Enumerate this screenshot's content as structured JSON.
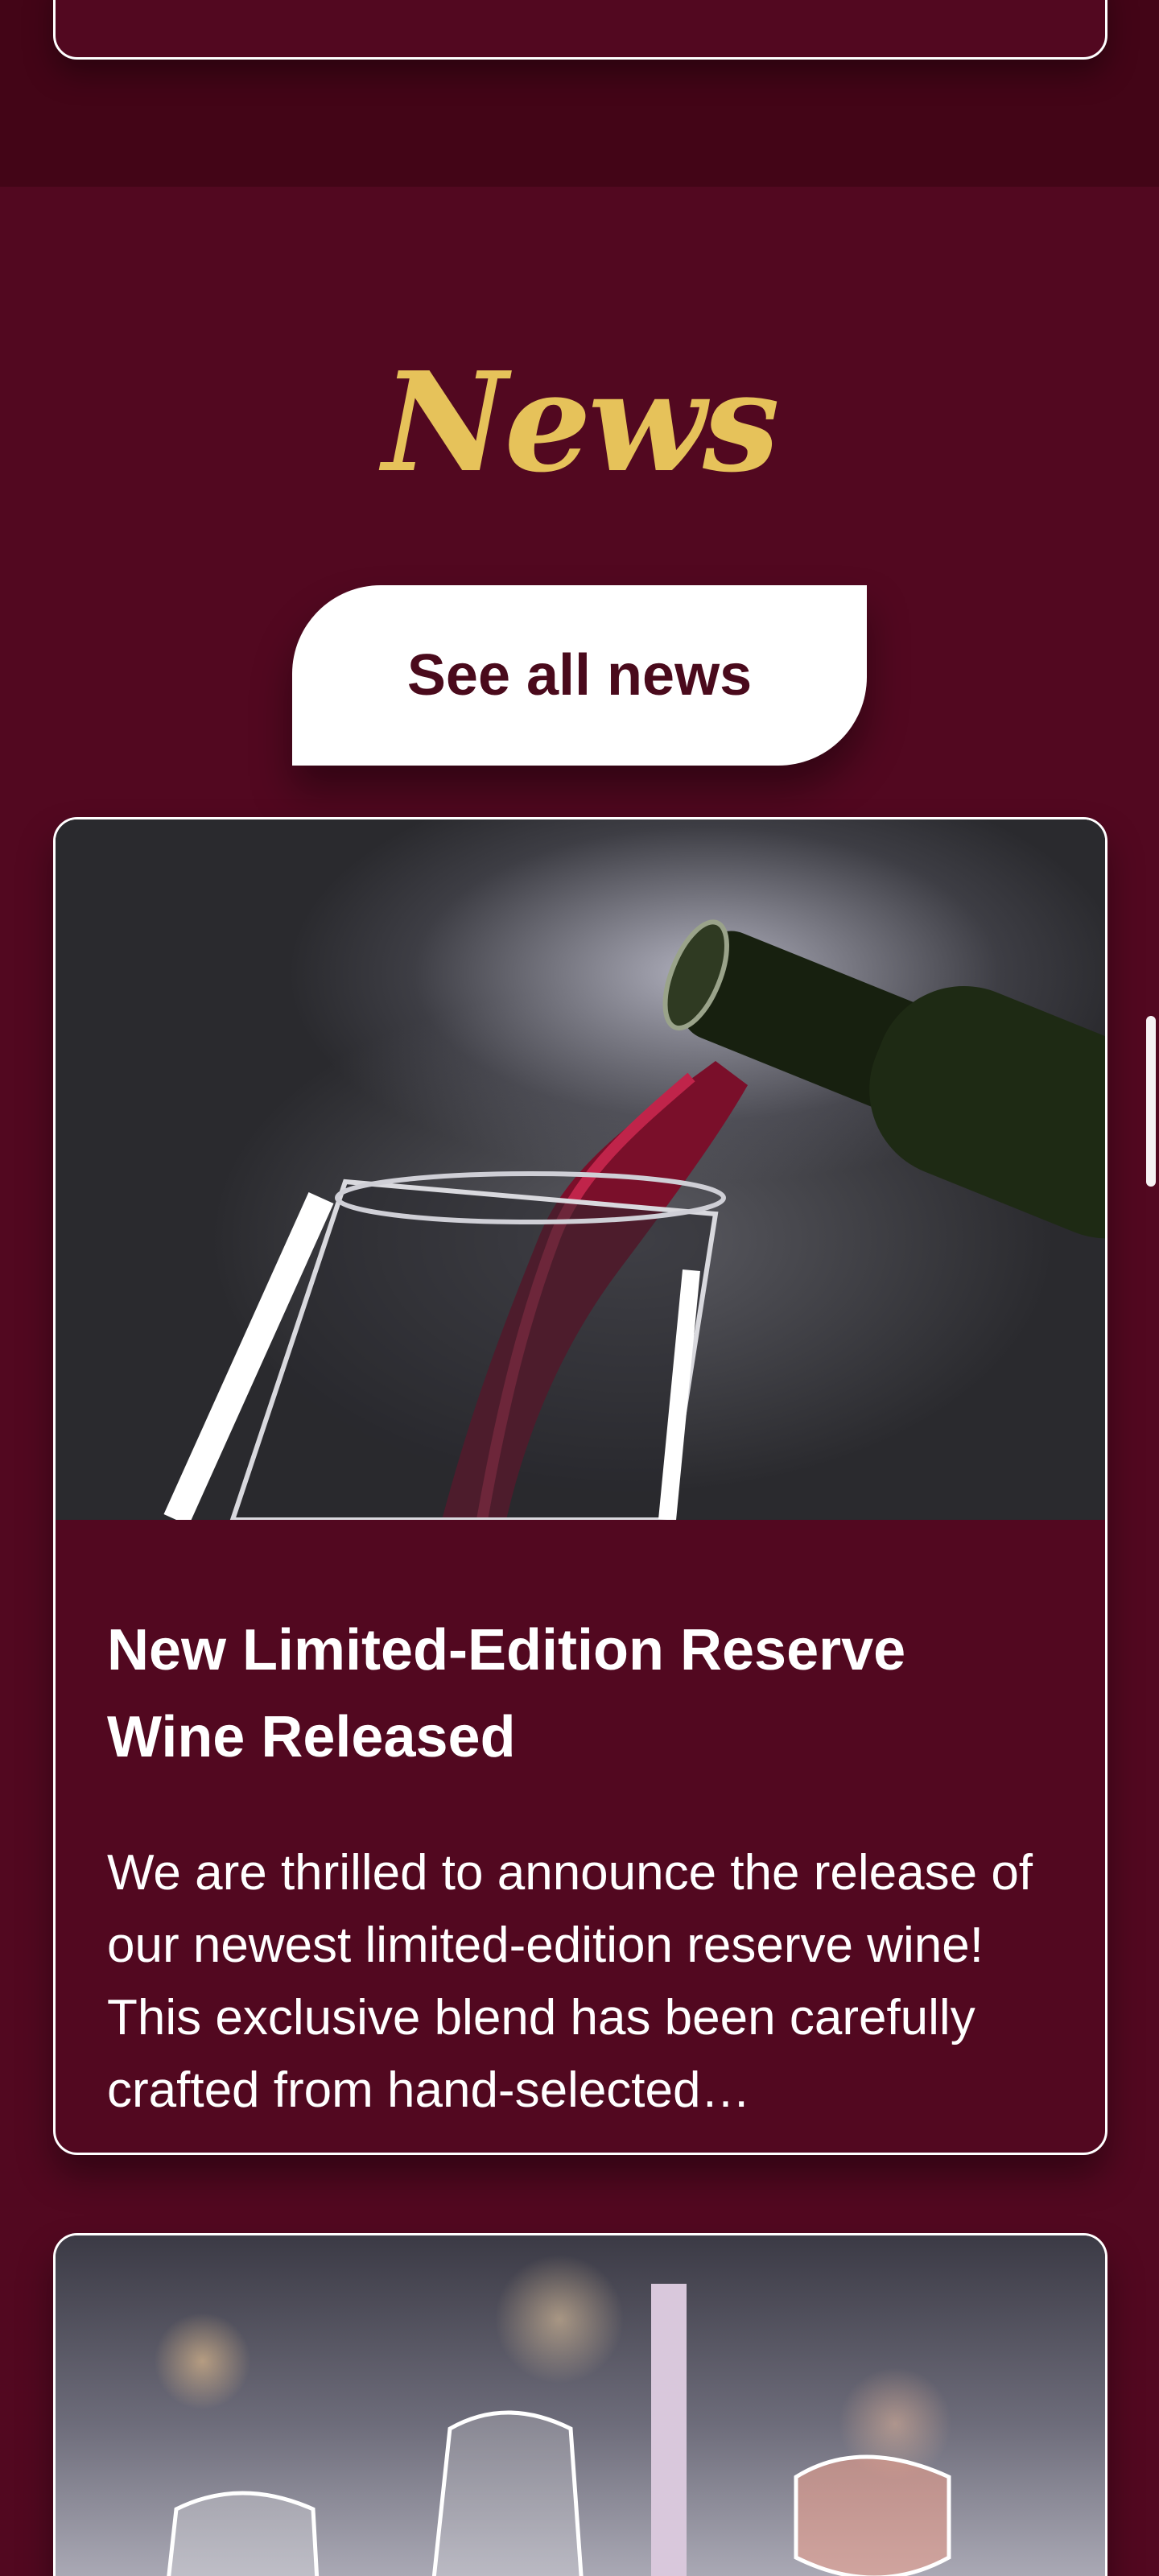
{
  "news": {
    "heading": "News",
    "see_all_label": "See all news",
    "accent_color": "#e6c25a",
    "background_color": "#520820"
  },
  "articles": [
    {
      "title": "New Limited-Edition Reserve Wine Released",
      "excerpt": "We are thrilled to announce the release of our newest limited-edition reserve wine! This exclusive blend has been carefully crafted from hand-selected…",
      "image": "wine-pouring-into-glass"
    },
    {
      "image": "wine-glasses-at-dinner-table"
    }
  ]
}
